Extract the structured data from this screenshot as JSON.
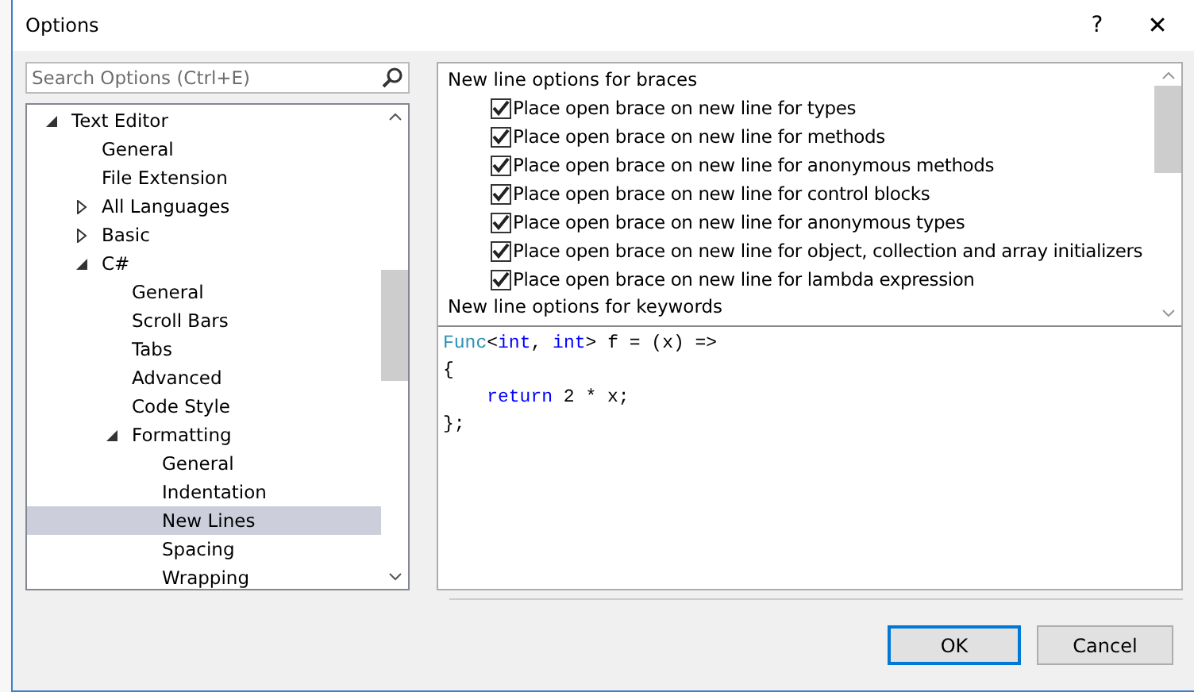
{
  "window": {
    "title": "Options",
    "help_glyph": "?",
    "close_glyph": "✕"
  },
  "search": {
    "placeholder": "Search Options (Ctrl+E)"
  },
  "tree": [
    {
      "label": "Text Editor",
      "expanded": true,
      "selected": false,
      "children": [
        {
          "label": "General",
          "selected": false
        },
        {
          "label": "File Extension",
          "selected": false
        },
        {
          "label": "All Languages",
          "expanded": false,
          "selected": false
        },
        {
          "label": "Basic",
          "expanded": false,
          "selected": false
        },
        {
          "label": "C#",
          "expanded": true,
          "selected": false,
          "children": [
            {
              "label": "General",
              "selected": false
            },
            {
              "label": "Scroll Bars",
              "selected": false
            },
            {
              "label": "Tabs",
              "selected": false
            },
            {
              "label": "Advanced",
              "selected": false
            },
            {
              "label": "Code Style",
              "selected": false
            },
            {
              "label": "Formatting",
              "expanded": true,
              "selected": false,
              "children": [
                {
                  "label": "General",
                  "selected": false
                },
                {
                  "label": "Indentation",
                  "selected": false
                },
                {
                  "label": "New Lines",
                  "selected": true
                },
                {
                  "label": "Spacing",
                  "selected": false
                },
                {
                  "label": "Wrapping",
                  "selected": false
                }
              ]
            }
          ]
        }
      ]
    }
  ],
  "options": [
    {
      "kind": "header",
      "label": "New line options for braces"
    },
    {
      "kind": "checkbox",
      "label": "Place open brace on new line for types",
      "checked": true
    },
    {
      "kind": "checkbox",
      "label": "Place open brace on new line for methods",
      "checked": true
    },
    {
      "kind": "checkbox",
      "label": "Place open brace on new line for anonymous methods",
      "checked": true
    },
    {
      "kind": "checkbox",
      "label": "Place open brace on new line for control blocks",
      "checked": true
    },
    {
      "kind": "checkbox",
      "label": "Place open brace on new line for anonymous types",
      "checked": true
    },
    {
      "kind": "checkbox",
      "label": "Place open brace on new line for object, collection and array initializers",
      "checked": true
    },
    {
      "kind": "checkbox",
      "label": "Place open brace on new line for lambda expression",
      "checked": true
    },
    {
      "kind": "header",
      "label": "New line options for keywords"
    }
  ],
  "preview": [
    [
      {
        "kind": "type",
        "text": "Func"
      },
      {
        "kind": "plain",
        "text": "<"
      },
      {
        "kind": "keyword",
        "text": "int"
      },
      {
        "kind": "plain",
        "text": ", "
      },
      {
        "kind": "keyword",
        "text": "int"
      },
      {
        "kind": "plain",
        "text": "> f = (x) =>"
      }
    ],
    [
      {
        "kind": "plain",
        "text": "{"
      }
    ],
    [
      {
        "kind": "keyword",
        "text": "    return"
      },
      {
        "kind": "plain",
        "text": " 2 * x;"
      }
    ],
    [
      {
        "kind": "plain",
        "text": "};"
      }
    ]
  ],
  "buttons": [
    {
      "label": "OK",
      "default": true
    },
    {
      "label": "Cancel",
      "default": false
    }
  ]
}
